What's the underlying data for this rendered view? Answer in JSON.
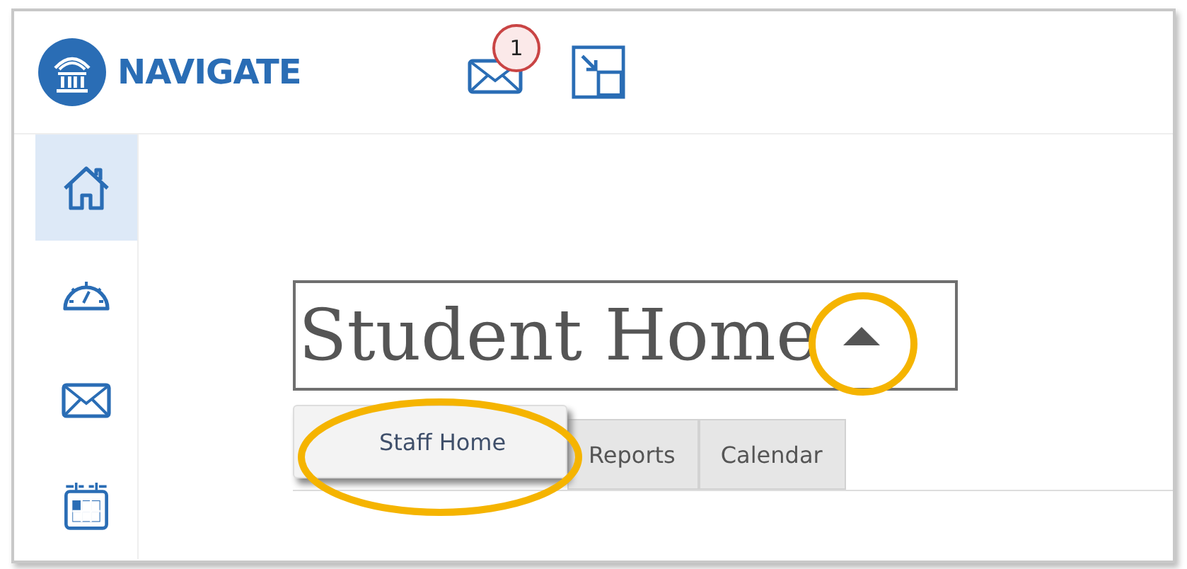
{
  "header": {
    "logo_text": "NAVIGATE",
    "mail_badge": "1"
  },
  "sidebar": {
    "items": [
      {
        "kind": "home",
        "selected": true
      },
      {
        "kind": "gauge",
        "selected": false
      },
      {
        "kind": "mail",
        "selected": false
      },
      {
        "kind": "calendar",
        "selected": false
      }
    ]
  },
  "page_selector": {
    "title": "Student Home",
    "expanded": true,
    "options": [
      "Staff Home"
    ]
  },
  "tabs": [
    {
      "label": "Reports"
    },
    {
      "label": "Calendar"
    }
  ]
}
